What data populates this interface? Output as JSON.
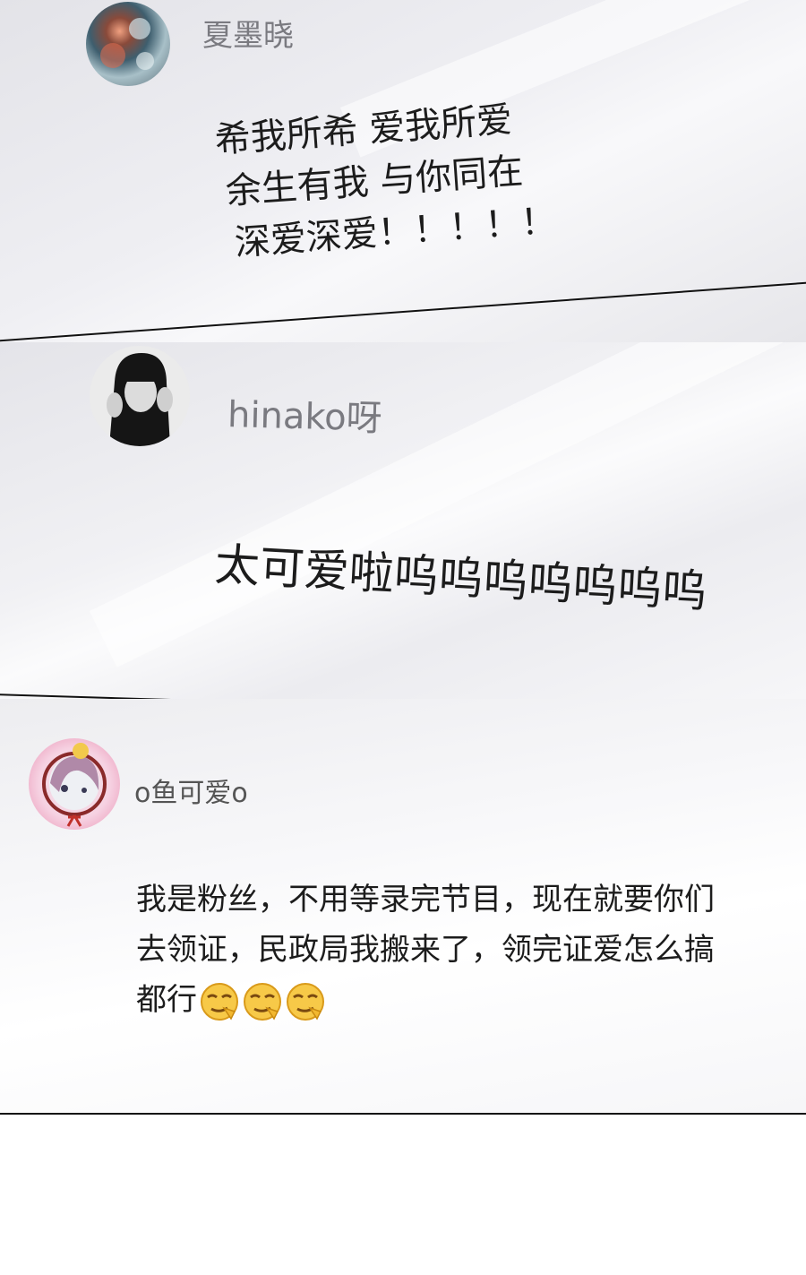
{
  "comments": [
    {
      "username": "夏墨晓",
      "lines": [
        "希我所希 爱我所爱",
        "余生有我 与你同在",
        "深爱深爱！！！！！"
      ]
    },
    {
      "username": "hinako呀",
      "lines": [
        "太可爱啦呜呜呜呜呜呜呜"
      ]
    },
    {
      "username": "o鱼可爱o",
      "lines": [
        "我是粉丝，不用等录完节目，现在就要你们",
        "去领证，民政局我搬来了，领完证爱怎么搞",
        "都行"
      ],
      "emoji": [
        "smirk-emoji",
        "smirk-emoji",
        "smirk-emoji"
      ]
    }
  ],
  "colors": {
    "text": "#1c1c1c",
    "username": "#7a7a80",
    "divider": "#111111"
  }
}
